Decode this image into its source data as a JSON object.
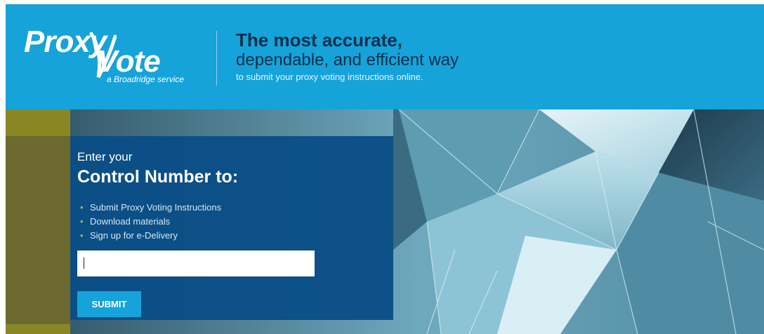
{
  "header": {
    "logo": {
      "brand_part1": "Proxy",
      "brand_part2": "Vote",
      "service": "a Broadridge service"
    },
    "tagline_line1": "The most accurate,",
    "tagline_line2": "dependable, and efficient way",
    "tagline_line3": "to submit your proxy voting instructions online."
  },
  "panel": {
    "intro": "Enter your",
    "heading": "Control Number to:",
    "bullets": [
      "Submit Proxy Voting Instructions",
      "Download materials",
      "Sign up for e-Delivery"
    ],
    "control_number_value": "",
    "submit_label": "SUBMIT"
  },
  "colors": {
    "header_bg": "#15a3da",
    "panel_bg": "#094e86",
    "olive_accent": "#8a8624",
    "bullet_dot": "#9bc33c"
  }
}
